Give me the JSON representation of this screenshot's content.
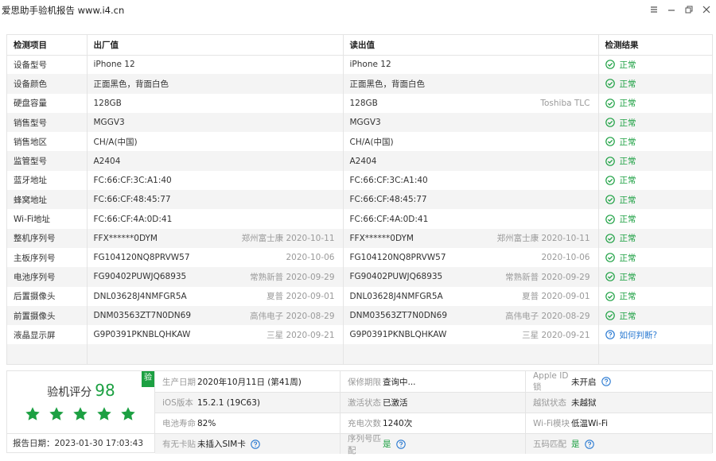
{
  "window": {
    "title": "爱思助手验机报告 www.i4.cn"
  },
  "table": {
    "headers": [
      "检测项目",
      "出厂值",
      "读出值",
      "检测结果"
    ],
    "rows": [
      {
        "item": "设备型号",
        "factory": "iPhone 12",
        "factory_note": "",
        "read": "iPhone 12",
        "read_note": "",
        "result": "正常",
        "status": "ok"
      },
      {
        "item": "设备颜色",
        "factory": "正面黑色，背面白色",
        "factory_note": "",
        "read": "正面黑色，背面白色",
        "read_note": "",
        "result": "正常",
        "status": "ok"
      },
      {
        "item": "硬盘容量",
        "factory": "128GB",
        "factory_note": "",
        "read": "128GB",
        "read_note": "Toshiba TLC",
        "result": "正常",
        "status": "ok"
      },
      {
        "item": "销售型号",
        "factory": "MGGV3",
        "factory_note": "",
        "read": "MGGV3",
        "read_note": "",
        "result": "正常",
        "status": "ok"
      },
      {
        "item": "销售地区",
        "factory": "CH/A(中国)",
        "factory_note": "",
        "read": "CH/A(中国)",
        "read_note": "",
        "result": "正常",
        "status": "ok"
      },
      {
        "item": "监管型号",
        "factory": "A2404",
        "factory_note": "",
        "read": "A2404",
        "read_note": "",
        "result": "正常",
        "status": "ok"
      },
      {
        "item": "蓝牙地址",
        "factory": "FC:66:CF:3C:A1:40",
        "factory_note": "",
        "read": "FC:66:CF:3C:A1:40",
        "read_note": "",
        "result": "正常",
        "status": "ok"
      },
      {
        "item": "蜂窝地址",
        "factory": "FC:66:CF:48:45:77",
        "factory_note": "",
        "read": "FC:66:CF:48:45:77",
        "read_note": "",
        "result": "正常",
        "status": "ok"
      },
      {
        "item": "Wi-Fi地址",
        "factory": "FC:66:CF:4A:0D:41",
        "factory_note": "",
        "read": "FC:66:CF:4A:0D:41",
        "read_note": "",
        "result": "正常",
        "status": "ok"
      },
      {
        "item": "整机序列号",
        "factory": "FFX******0DYM",
        "factory_note": "郑州富士康 2020-10-11",
        "read": "FFX******0DYM",
        "read_note": "郑州富士康 2020-10-11",
        "result": "正常",
        "status": "ok"
      },
      {
        "item": "主板序列号",
        "factory": "FG104120NQ8PRVW57",
        "factory_note": "2020-10-06",
        "read": "FG104120NQ8PRVW57",
        "read_note": "2020-10-06",
        "result": "正常",
        "status": "ok"
      },
      {
        "item": "电池序列号",
        "factory": "FG90402PUWJQ68935",
        "factory_note": "常熟新普 2020-09-29",
        "read": "FG90402PUWJQ68935",
        "read_note": "常熟新普 2020-09-29",
        "result": "正常",
        "status": "ok"
      },
      {
        "item": "后置摄像头",
        "factory": "DNL03628J4NMFGR5A",
        "factory_note": "夏普 2020-09-01",
        "read": "DNL03628J4NMFGR5A",
        "read_note": "夏普 2020-09-01",
        "result": "正常",
        "status": "ok"
      },
      {
        "item": "前置摄像头",
        "factory": "DNM03563ZT7N0DN69",
        "factory_note": "高伟电子 2020-08-29",
        "read": "DNM03563ZT7N0DN69",
        "read_note": "高伟电子 2020-08-29",
        "result": "正常",
        "status": "ok"
      },
      {
        "item": "液晶显示屏",
        "factory": "G9P0391PKNBLQHKAW",
        "factory_note": "三星 2020-09-21",
        "read": "G9P0391PKNBLQHKAW",
        "read_note": "三星 2020-09-21",
        "result": "如何判断?",
        "status": "question"
      }
    ]
  },
  "summary": {
    "score_label": "验机评分",
    "score": "98",
    "badge": "验",
    "stars": 5,
    "report_date": "报告日期：2023-01-30 17:03:43",
    "rows": [
      [
        {
          "label": "生产日期",
          "value": "2020年10月11日 (第41周)",
          "green": false,
          "help": false
        },
        {
          "label": "保修期限",
          "value": "查询中...",
          "green": false,
          "help": false
        },
        {
          "label": "Apple ID锁",
          "value": "未开启",
          "green": false,
          "help": true
        }
      ],
      [
        {
          "label": "iOS版本",
          "value": "15.2.1 (19C63)",
          "green": false,
          "help": false
        },
        {
          "label": "激活状态",
          "value": "已激活",
          "green": false,
          "help": false
        },
        {
          "label": "越狱状态",
          "value": "未越狱",
          "green": false,
          "help": false
        }
      ],
      [
        {
          "label": "电池寿命",
          "value": "82%",
          "green": false,
          "help": false
        },
        {
          "label": "充电次数",
          "value": "1240次",
          "green": false,
          "help": false
        },
        {
          "label": "Wi-Fi模块",
          "value": "低温Wi-Fi",
          "green": false,
          "help": false
        }
      ],
      [
        {
          "label": "有无卡贴",
          "value": "未插入SIM卡",
          "green": false,
          "help": true
        },
        {
          "label": "序列号匹配",
          "value": "是",
          "green": true,
          "help": true
        },
        {
          "label": "五码匹配",
          "value": "是",
          "green": true,
          "help": true
        }
      ]
    ]
  },
  "colors": {
    "ok_green": "#1ca042",
    "link_blue": "#2a7ad2",
    "star_green": "#1ca042"
  }
}
